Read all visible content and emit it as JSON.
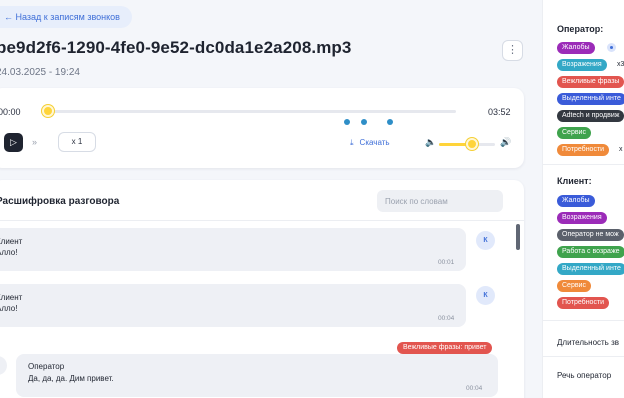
{
  "back_link": "← Назад к записям звонков",
  "file": {
    "title": "be9d2f6-1290-4fe0-9e52-dc0da1e2a208.mp3",
    "date": "24.03.2025 - 19:24",
    "more_icon": "⋮"
  },
  "player": {
    "time_start": "00:00",
    "time_end": "03:52",
    "progress": 0.0,
    "volume": 0.62,
    "play_icon": "▷",
    "ff_icon": "»",
    "speed": "x 1",
    "download_icon": "⤓",
    "download_label": "Скачать",
    "volume_min_icon": "🔈",
    "volume_max_icon": "🔊",
    "accent_color": "#ffd43a",
    "marker_color": "#2e8ec7"
  },
  "transcript": {
    "title": "Расшифровка разговора",
    "search_placeholder": "Поиск по словам",
    "messages": [
      {
        "speaker": "Клиент",
        "text": "Алло!",
        "time": "00:01",
        "avatar": "К"
      },
      {
        "speaker": "Клиент",
        "text": "Алло!",
        "time": "00:04",
        "avatar": "К"
      },
      {
        "speaker": "Оператор",
        "text": "Да, да, да. Дим привет.",
        "time": "00:04",
        "tag": "Вежливые фразы: привет"
      }
    ]
  },
  "sidebar": {
    "operator_title": "Оператор:",
    "operator_tags": [
      {
        "label": "Жалобы",
        "color": "#9b2bb8"
      },
      {
        "label": "Возражения",
        "color": "#33a8c6",
        "count": "x3"
      },
      {
        "label": "Вежливые фразы",
        "color": "#e2554f"
      },
      {
        "label": "Выделенный инте",
        "color": "#3a5bd9"
      },
      {
        "label": "Adtech и продвиж",
        "color": "#333840"
      },
      {
        "label": "Сервис",
        "color": "#3fa34d"
      },
      {
        "label": "Потребности",
        "color": "#f08a3a",
        "count": "x"
      }
    ],
    "client_title": "Клиент:",
    "client_tags": [
      {
        "label": "Жалобы",
        "color": "#3a5bd9"
      },
      {
        "label": "Возражения",
        "color": "#9b2bb8"
      },
      {
        "label": "Оператор не мож",
        "color": "#5b606b"
      },
      {
        "label": "Работа с возраже",
        "color": "#3fa34d"
      },
      {
        "label": "Выделенный инте",
        "color": "#33a8c6"
      },
      {
        "label": "Сервис",
        "color": "#f08a3a"
      },
      {
        "label": "Потребности",
        "color": "#e2554f"
      }
    ],
    "duration_label": "Длительность зв",
    "speech_label": "Речь оператор"
  }
}
